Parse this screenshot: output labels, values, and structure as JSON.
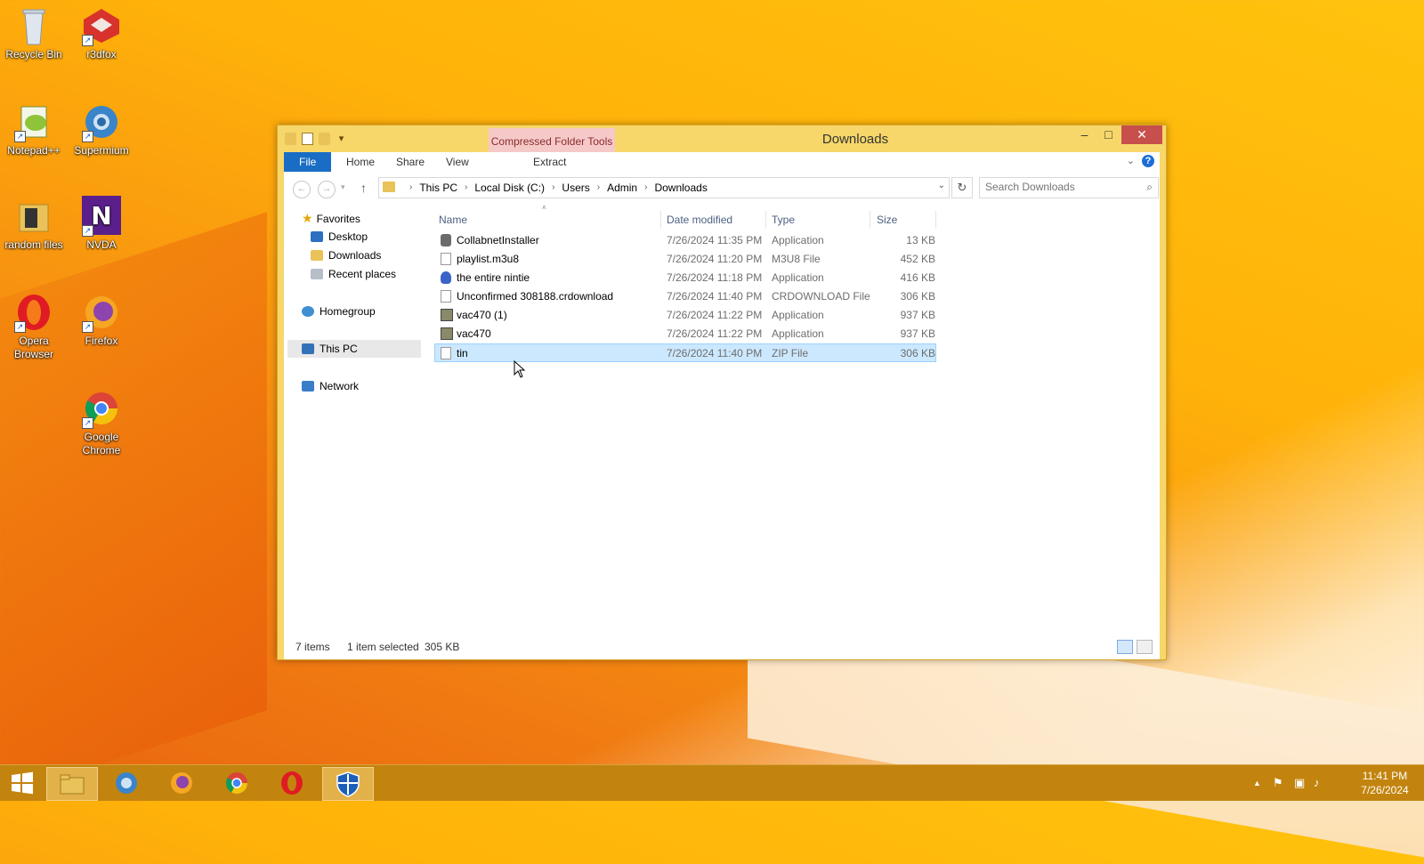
{
  "desktop": {
    "icons": [
      {
        "label": "Recycle Bin"
      },
      {
        "label": "r3dfox"
      },
      {
        "label": "Notepad++"
      },
      {
        "label": "Supermium"
      },
      {
        "label": "random files"
      },
      {
        "label": "NVDA"
      },
      {
        "label": "Opera Browser"
      },
      {
        "label": "Firefox"
      },
      {
        "label": "Google Chrome"
      }
    ]
  },
  "window": {
    "title": "Downloads",
    "contextual_tab": "Compressed Folder Tools",
    "controls": {
      "minimize": "–",
      "maximize": "□",
      "close": "✕"
    },
    "ribbon_tabs": [
      "File",
      "Home",
      "Share",
      "View",
      "Extract"
    ],
    "help_glyph": "?",
    "address": {
      "crumbs": [
        "This PC",
        "Local Disk (C:)",
        "Users",
        "Admin",
        "Downloads"
      ]
    },
    "search": {
      "placeholder": "Search Downloads"
    },
    "nav_pane": {
      "items": [
        {
          "label": "Favorites",
          "icon": "star-icon"
        },
        {
          "label": "Desktop",
          "icon": "desktop-folder-icon"
        },
        {
          "label": "Downloads",
          "icon": "downloads-folder-icon"
        },
        {
          "label": "Recent places",
          "icon": "recent-places-icon"
        },
        {
          "label": "Homegroup",
          "icon": "homegroup-icon"
        },
        {
          "label": "This PC",
          "icon": "this-pc-icon",
          "selected": true
        },
        {
          "label": "Network",
          "icon": "network-icon"
        }
      ]
    },
    "columns": [
      "Name",
      "Date modified",
      "Type",
      "Size"
    ],
    "files": [
      {
        "name": "CollabnetInstaller",
        "date": "7/26/2024 11:35 PM",
        "type": "Application",
        "size": "13 KB",
        "icon": "installer-icon"
      },
      {
        "name": "playlist.m3u8",
        "date": "7/26/2024 11:20 PM",
        "type": "M3U8 File",
        "size": "452 KB",
        "icon": "file-icon"
      },
      {
        "name": "the entire nintie",
        "date": "7/26/2024 11:18 PM",
        "type": "Application",
        "size": "416 KB",
        "icon": "app-icon"
      },
      {
        "name": "Unconfirmed 308188.crdownload",
        "date": "7/26/2024 11:40 PM",
        "type": "CRDOWNLOAD File",
        "size": "306 KB",
        "icon": "file-icon"
      },
      {
        "name": "vac470 (1)",
        "date": "7/26/2024 11:22 PM",
        "type": "Application",
        "size": "937 KB",
        "icon": "app-window-icon"
      },
      {
        "name": "vac470",
        "date": "7/26/2024 11:22 PM",
        "type": "Application",
        "size": "937 KB",
        "icon": "app-window-icon"
      },
      {
        "name": "tin",
        "date": "7/26/2024 11:40 PM",
        "type": "ZIP File",
        "size": "306 KB",
        "icon": "zip-icon",
        "selected": true
      }
    ],
    "status": {
      "items": "7 items",
      "selection": "1 item selected",
      "selection_size": "305 KB"
    }
  },
  "taskbar": {
    "clock_time": "11:41 PM",
    "clock_date": "7/26/2024"
  }
}
